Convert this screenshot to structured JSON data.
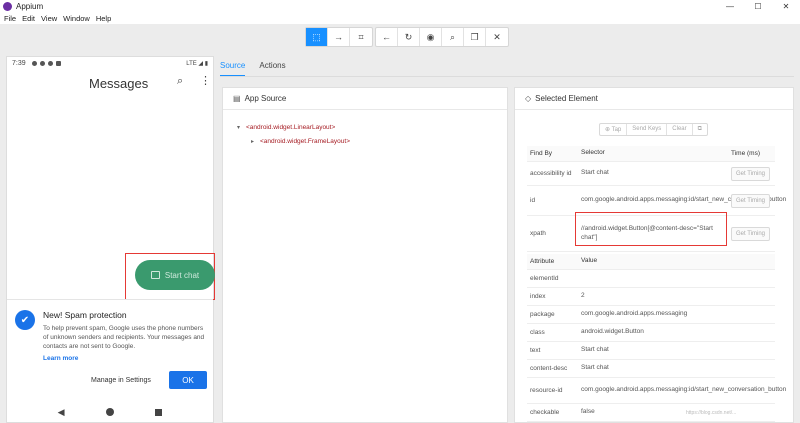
{
  "window": {
    "title": "Appium",
    "controls": [
      "—",
      "☐",
      "✕"
    ]
  },
  "menu": [
    "File",
    "Edit",
    "View",
    "Window",
    "Help"
  ],
  "toolbar": {
    "group1": [
      {
        "icon": "select-element-icon",
        "glyph": "⬚",
        "active": true
      },
      {
        "icon": "swipe-icon",
        "glyph": "→",
        "active": false
      },
      {
        "icon": "tap-coordinates-icon",
        "glyph": "⌗",
        "active": false
      }
    ],
    "group2": [
      {
        "icon": "back-icon",
        "glyph": "←"
      },
      {
        "icon": "refresh-icon",
        "glyph": "↻"
      },
      {
        "icon": "eye-icon",
        "glyph": "◉"
      },
      {
        "icon": "search-icon",
        "glyph": "⌕"
      },
      {
        "icon": "copy-icon",
        "glyph": "❐"
      },
      {
        "icon": "close-icon",
        "glyph": "✕"
      }
    ]
  },
  "device": {
    "time": "7:39",
    "status_right": "LTE ◢ ▮",
    "title": "Messages",
    "start_chat": "Start chat",
    "spam": {
      "title": "New! Spam protection",
      "body": "To help prevent spam, Google uses the phone numbers of unknown senders and recipients. Your messages and contacts are not sent to Google.",
      "learn_more": "Learn more",
      "manage": "Manage in Settings",
      "ok": "OK"
    }
  },
  "tabs": {
    "source": "Source",
    "actions": "Actions"
  },
  "app_source": {
    "title": "App Source",
    "nodes": [
      {
        "label": "<android.widget.LinearLayout>",
        "caret": "▾"
      },
      {
        "label": "<android.widget.FrameLayout>",
        "caret": "▸"
      }
    ]
  },
  "selected": {
    "title": "Selected Element",
    "actions": [
      "⊕ Tap",
      "Send Keys",
      "Clear",
      "⧉"
    ],
    "find_header": {
      "find_by": "Find By",
      "selector": "Selector",
      "time": "Time (ms)"
    },
    "find_rows": [
      {
        "by": "accessibility id",
        "selector": "Start chat",
        "btn": "Get Timing"
      },
      {
        "by": "id",
        "selector": "com.google.android.apps.messaging:id/start_new_conversation_button",
        "btn": "Get Timing"
      },
      {
        "by": "xpath",
        "selector": "//android.widget.Button[@content-desc=\"Start chat\"]",
        "btn": "Get Timing"
      }
    ],
    "attr_header": {
      "attribute": "Attribute",
      "value": "Value"
    },
    "attr_rows": [
      {
        "name": "elementId",
        "value": ""
      },
      {
        "name": "index",
        "value": "2"
      },
      {
        "name": "package",
        "value": "com.google.android.apps.messaging"
      },
      {
        "name": "class",
        "value": "android.widget.Button"
      },
      {
        "name": "text",
        "value": "Start chat"
      },
      {
        "name": "content-desc",
        "value": "Start chat"
      },
      {
        "name": "resource-id",
        "value": "com.google.android.apps.messaging:id/start_new_conversation_button"
      },
      {
        "name": "checkable",
        "value": "false"
      }
    ]
  },
  "watermark": "https://blog.csdn.net/..."
}
